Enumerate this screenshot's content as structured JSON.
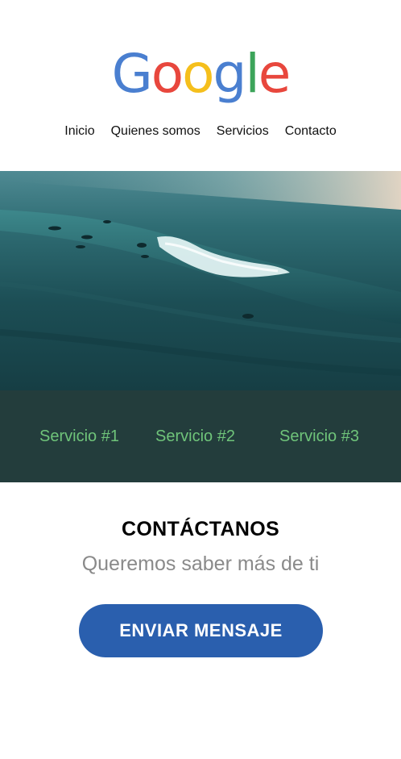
{
  "brand": {
    "logo_letters": [
      "G",
      "o",
      "o",
      "g",
      "l",
      "e"
    ],
    "logo_colors": [
      "#4a7fd0",
      "#e8473d",
      "#f5bf1c",
      "#4a7fd0",
      "#3ca45a",
      "#e8473d"
    ]
  },
  "nav": {
    "items": [
      "Inicio",
      "Quienes somos",
      "Servicios",
      "Contacto"
    ]
  },
  "hero": {
    "image": "ocean-wave-surfers"
  },
  "services": {
    "items": [
      "Servicio #1",
      "Servicio #2",
      "Servicio #3"
    ],
    "background": "#233d3c",
    "text_color": "#6fc47a"
  },
  "contact": {
    "title": "CONTÁCTANOS",
    "subtitle": "Queremos saber más de ti",
    "button_label": "ENVIAR MENSAJE",
    "button_color": "#2a5fae"
  }
}
